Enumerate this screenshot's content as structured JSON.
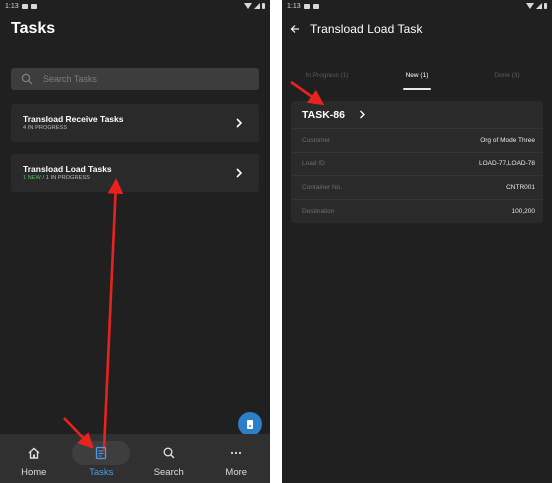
{
  "left_screen": {
    "status_bar": {
      "time": "1:13"
    },
    "title": "Tasks",
    "search": {
      "placeholder": "Search Tasks",
      "icon": "search-icon"
    },
    "task_cards": [
      {
        "title": "Transload Receive Tasks",
        "subtitle": "4 IN PROGRESS"
      },
      {
        "title": "Transload Load Tasks",
        "subtitle_new": "1 NEW",
        "subtitle_rest": " / 1 IN PROGRESS"
      }
    ],
    "fab": {
      "icon": "device-icon"
    },
    "bottom_nav": [
      {
        "label": "Home",
        "icon": "home-icon"
      },
      {
        "label": "Tasks",
        "icon": "tasks-icon",
        "active": true
      },
      {
        "label": "Search",
        "icon": "search-icon"
      },
      {
        "label": "More",
        "icon": "more-icon"
      }
    ],
    "colors": {
      "background": "#202020",
      "accent": "#4d9be8",
      "new_green": "#56c26a",
      "fab": "#2e7ec8"
    }
  },
  "right_screen": {
    "status_bar": {
      "time": "1:13"
    },
    "title": "Transload Load Task",
    "tabs": [
      {
        "label": "In Progress (1)"
      },
      {
        "label": "New (1)",
        "active": true
      },
      {
        "label": "Done (3)"
      }
    ],
    "task": {
      "id": "TASK-86",
      "fields": [
        {
          "label": "Customer",
          "value": "Org of Mode Three"
        },
        {
          "label": "Load ID",
          "value": "LOAD-77,LOAD-78"
        },
        {
          "label": "Container No.",
          "value": "CNTR001"
        },
        {
          "label": "Destination",
          "value": "100,200"
        }
      ]
    }
  },
  "annotations": {
    "arrow_color": "#e8231e"
  }
}
